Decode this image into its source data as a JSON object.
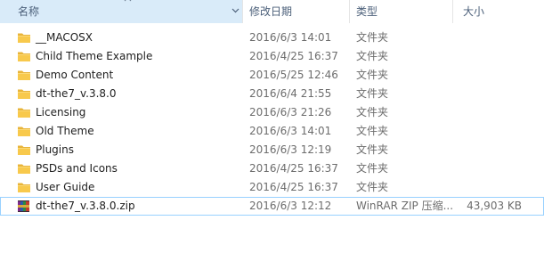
{
  "columns": {
    "name": "名称",
    "modified": "修改日期",
    "type": "类型",
    "size": "大小"
  },
  "colors": {
    "header_text": "#4c607a",
    "selected_header_bg": "#d9ebf9",
    "folder_yellow": "#f8c94c",
    "focus_outline": "#99d1ff"
  },
  "files": [
    {
      "name": "__MACOSX",
      "modified": "2016/6/3 14:01",
      "type": "文件夹",
      "size": "",
      "icon": "folder-icon"
    },
    {
      "name": "Child Theme Example",
      "modified": "2016/4/25 16:37",
      "type": "文件夹",
      "size": "",
      "icon": "folder-icon"
    },
    {
      "name": "Demo Content",
      "modified": "2016/5/25 12:46",
      "type": "文件夹",
      "size": "",
      "icon": "folder-icon"
    },
    {
      "name": "dt-the7_v.3.8.0",
      "modified": "2016/6/4 21:55",
      "type": "文件夹",
      "size": "",
      "icon": "folder-icon"
    },
    {
      "name": "Licensing",
      "modified": "2016/6/3 21:26",
      "type": "文件夹",
      "size": "",
      "icon": "folder-icon"
    },
    {
      "name": "Old Theme",
      "modified": "2016/6/3 14:01",
      "type": "文件夹",
      "size": "",
      "icon": "folder-icon"
    },
    {
      "name": "Plugins",
      "modified": "2016/6/3 12:19",
      "type": "文件夹",
      "size": "",
      "icon": "folder-icon"
    },
    {
      "name": "PSDs and Icons",
      "modified": "2016/4/25 16:37",
      "type": "文件夹",
      "size": "",
      "icon": "folder-icon"
    },
    {
      "name": "User Guide",
      "modified": "2016/4/25 16:37",
      "type": "文件夹",
      "size": "",
      "icon": "folder-icon"
    },
    {
      "name": "dt-the7_v.3.8.0.zip",
      "modified": "2016/6/3 12:12",
      "type": "WinRAR ZIP 压缩...",
      "size": "43,903 KB",
      "icon": "winrar-archive-icon"
    }
  ]
}
